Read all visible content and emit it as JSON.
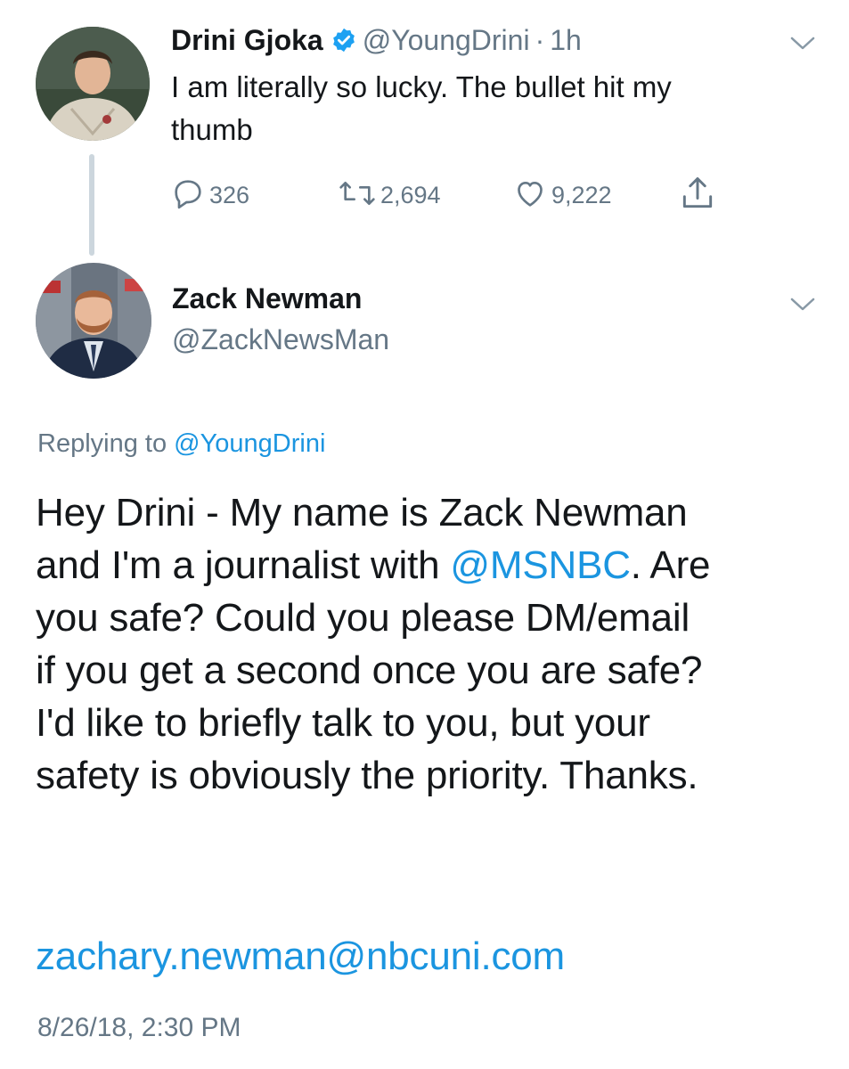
{
  "tweet1": {
    "author_name": "Drini Gjoka",
    "handle": "@YoungDrini",
    "dot": "·",
    "time": "1h",
    "text_line1": "I am literally so lucky. The bullet hit my",
    "text_line2": "thumb",
    "replies": "326",
    "retweets": "2,694",
    "likes": "9,222"
  },
  "tweet2": {
    "author_name": "Zack Newman",
    "handle": "@ZackNewsMan",
    "replying_prefix": "Replying to ",
    "replying_handle": "@YoungDrini",
    "body_line1": "Hey Drini - My name is Zack Newman",
    "body_line2_pre": "and I'm a journalist with ",
    "body_mention": "@MSNBC",
    "body_line2_post": ". Are",
    "body_line3": "you safe? Could you please DM/email",
    "body_line4": "if you get a second once you are safe?",
    "body_line5": "I'd like to briefly talk to you, but your",
    "body_line6": "safety is obviously the priority. Thanks.",
    "email": "zachary.newman@nbcuni.com",
    "timestamp": "8/26/18, 2:30 PM"
  },
  "colors": {
    "link": "#1b95e0",
    "muted": "#657786",
    "text": "#14171a",
    "thread_line": "#ccd6dd"
  },
  "icons": [
    "verified-badge-icon",
    "reply-icon",
    "retweet-icon",
    "like-icon",
    "share-icon",
    "chevron-down-icon"
  ]
}
